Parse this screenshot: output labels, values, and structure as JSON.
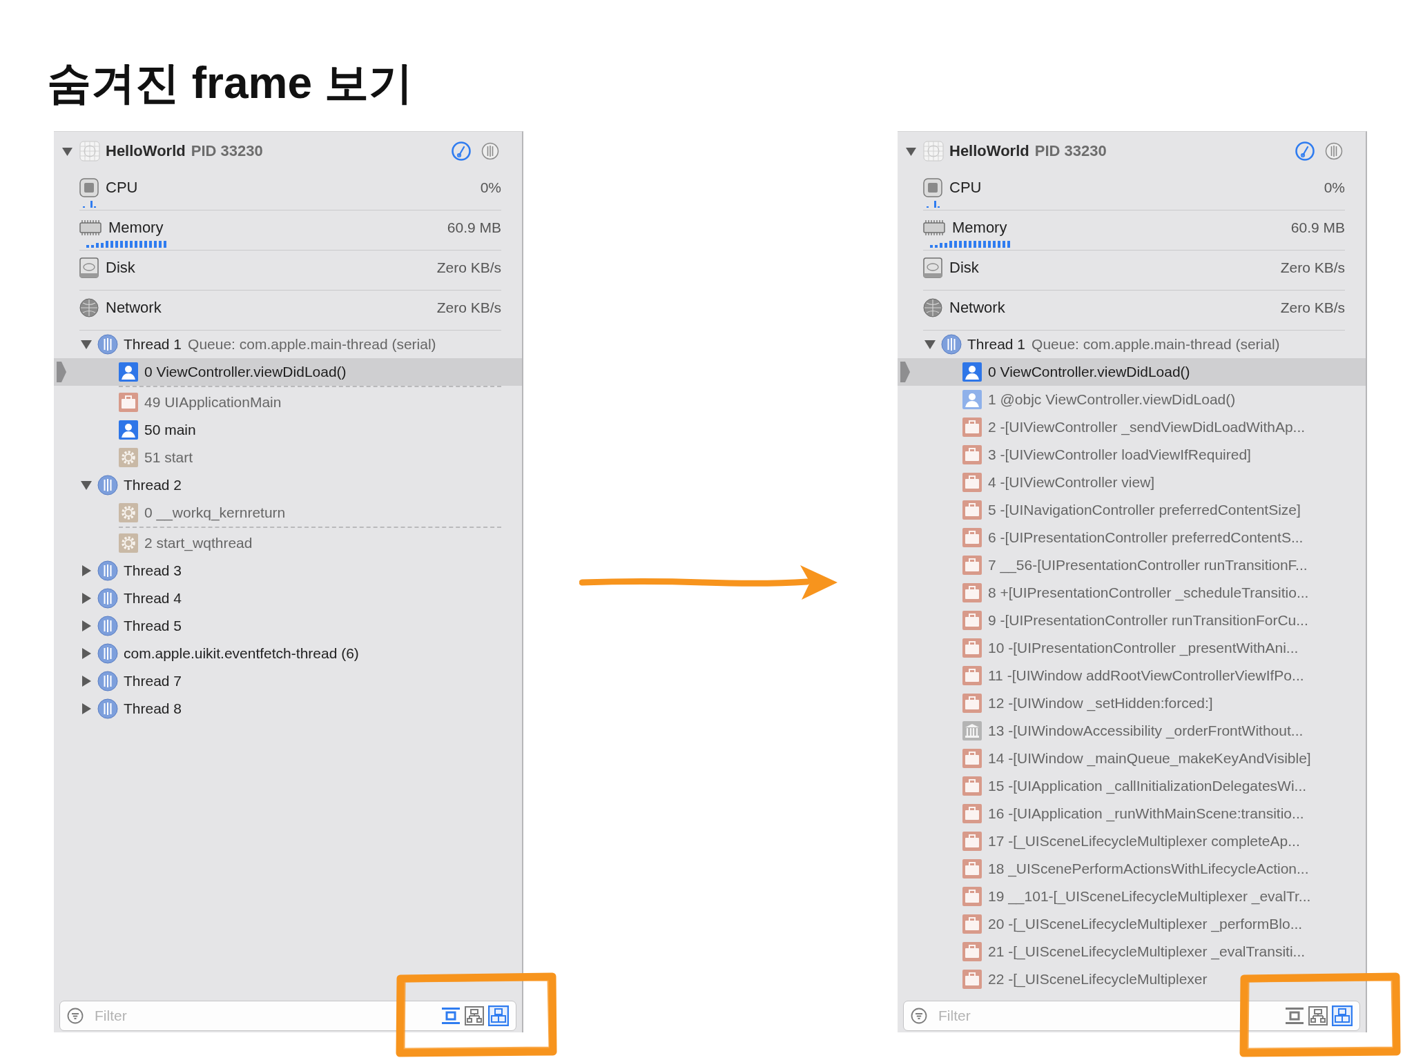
{
  "title": "숨겨진 frame 보기",
  "panels": [
    {
      "process": {
        "name": "HelloWorld",
        "pid": "PID 33230",
        "expanded": true
      },
      "metrics": [
        {
          "kind": "cpu",
          "label": "CPU",
          "value": "0%"
        },
        {
          "kind": "memory",
          "label": "Memory",
          "value": "60.9 MB"
        },
        {
          "kind": "disk",
          "label": "Disk",
          "value": "Zero KB/s"
        },
        {
          "kind": "network",
          "label": "Network",
          "value": "Zero KB/s"
        }
      ],
      "threads": [
        {
          "name": "Thread 1",
          "queue": "Queue: com.apple.main-thread (serial)",
          "expanded": true,
          "frames": [
            {
              "kind": "user",
              "label": "0 ViewController.viewDidLoad()",
              "dimmed": false,
              "selected": true,
              "gap_after": true
            },
            {
              "kind": "framework",
              "label": "49 UIApplicationMain",
              "dimmed": true,
              "selected": false,
              "gap_after": false
            },
            {
              "kind": "user",
              "label": "50 main",
              "dimmed": false,
              "selected": false,
              "gap_after": false
            },
            {
              "kind": "system",
              "label": "51 start",
              "dimmed": true,
              "selected": false,
              "gap_after": false
            }
          ]
        },
        {
          "name": "Thread 2",
          "expanded": true,
          "frames": [
            {
              "kind": "system",
              "label": "0 __workq_kernreturn",
              "dimmed": true,
              "selected": false,
              "gap_after": true
            },
            {
              "kind": "system",
              "label": "2 start_wqthread",
              "dimmed": true,
              "selected": false,
              "gap_after": false
            }
          ]
        },
        {
          "name": "Thread 3",
          "expanded": false
        },
        {
          "name": "Thread 4",
          "expanded": false
        },
        {
          "name": "Thread 5",
          "expanded": false
        },
        {
          "name": "com.apple.uikit.eventfetch-thread (6)",
          "expanded": false
        },
        {
          "name": "Thread 7",
          "expanded": false
        },
        {
          "name": "Thread 8",
          "expanded": false
        }
      ],
      "filter": {
        "placeholder": "Filter",
        "toggles": [
          {
            "on": true
          },
          {
            "on": false
          },
          {
            "on": true
          }
        ]
      }
    },
    {
      "process": {
        "name": "HelloWorld",
        "pid": "PID 33230",
        "expanded": true
      },
      "metrics": [
        {
          "kind": "cpu",
          "label": "CPU",
          "value": "0%"
        },
        {
          "kind": "memory",
          "label": "Memory",
          "value": "60.9 MB"
        },
        {
          "kind": "disk",
          "label": "Disk",
          "value": "Zero KB/s"
        },
        {
          "kind": "network",
          "label": "Network",
          "value": "Zero KB/s"
        }
      ],
      "threads": [
        {
          "name": "Thread 1",
          "queue": "Queue: com.apple.main-thread (serial)",
          "expanded": true,
          "frames": [
            {
              "kind": "user",
              "label": "0 ViewController.viewDidLoad()",
              "dimmed": false,
              "selected": true,
              "gap_after": false
            },
            {
              "kind": "user",
              "label": "1 @objc ViewController.viewDidLoad()",
              "dimmed": true,
              "selected": false,
              "gap_after": false
            },
            {
              "kind": "framework",
              "label": "2 -[UIViewController _sendViewDidLoadWithAp...",
              "dimmed": true,
              "selected": false,
              "gap_after": false
            },
            {
              "kind": "framework",
              "label": "3 -[UIViewController loadViewIfRequired]",
              "dimmed": true,
              "selected": false,
              "gap_after": false
            },
            {
              "kind": "framework",
              "label": "4 -[UIViewController view]",
              "dimmed": true,
              "selected": false,
              "gap_after": false
            },
            {
              "kind": "framework",
              "label": "5 -[UINavigationController preferredContentSize]",
              "dimmed": true,
              "selected": false,
              "gap_after": false
            },
            {
              "kind": "framework",
              "label": "6 -[UIPresentationController preferredContentS...",
              "dimmed": true,
              "selected": false,
              "gap_after": false
            },
            {
              "kind": "framework",
              "label": "7 __56-[UIPresentationController runTransitionF...",
              "dimmed": true,
              "selected": false,
              "gap_after": false
            },
            {
              "kind": "framework",
              "label": "8 +[UIPresentationController _scheduleTransitio...",
              "dimmed": true,
              "selected": false,
              "gap_after": false
            },
            {
              "kind": "framework",
              "label": "9 -[UIPresentationController runTransitionForCu...",
              "dimmed": true,
              "selected": false,
              "gap_after": false
            },
            {
              "kind": "framework",
              "label": "10 -[UIPresentationController _presentWithAni...",
              "dimmed": true,
              "selected": false,
              "gap_after": false
            },
            {
              "kind": "framework",
              "label": "11 -[UIWindow addRootViewControllerViewIfPo...",
              "dimmed": true,
              "selected": false,
              "gap_after": false
            },
            {
              "kind": "framework",
              "label": "12 -[UIWindow _setHidden:forced:]",
              "dimmed": true,
              "selected": false,
              "gap_after": false
            },
            {
              "kind": "library",
              "label": "13 -[UIWindowAccessibility _orderFrontWithout...",
              "dimmed": true,
              "selected": false,
              "gap_after": false
            },
            {
              "kind": "framework",
              "label": "14 -[UIWindow _mainQueue_makeKeyAndVisible]",
              "dimmed": true,
              "selected": false,
              "gap_after": false
            },
            {
              "kind": "framework",
              "label": "15 -[UIApplication _callInitializationDelegatesWi...",
              "dimmed": true,
              "selected": false,
              "gap_after": false
            },
            {
              "kind": "framework",
              "label": "16 -[UIApplication _runWithMainScene:transitio...",
              "dimmed": true,
              "selected": false,
              "gap_after": false
            },
            {
              "kind": "framework",
              "label": "17 -[_UISceneLifecycleMultiplexer completeAp...",
              "dimmed": true,
              "selected": false,
              "gap_after": false
            },
            {
              "kind": "framework",
              "label": "18 _UIScenePerformActionsWithLifecycleAction...",
              "dimmed": true,
              "selected": false,
              "gap_after": false
            },
            {
              "kind": "framework",
              "label": "19 __101-[_UISceneLifecycleMultiplexer _evalTr...",
              "dimmed": true,
              "selected": false,
              "gap_after": false
            },
            {
              "kind": "framework",
              "label": "20 -[_UISceneLifecycleMultiplexer _performBlo...",
              "dimmed": true,
              "selected": false,
              "gap_after": false
            },
            {
              "kind": "framework",
              "label": "21 -[_UISceneLifecycleMultiplexer _evalTransiti...",
              "dimmed": true,
              "selected": false,
              "gap_after": false
            },
            {
              "kind": "framework",
              "label": "22 -[_UISceneLifecycleMultiplexer",
              "dimmed": true,
              "selected": false,
              "gap_after": false
            }
          ]
        }
      ],
      "filter": {
        "placeholder": "Filter",
        "toggles": [
          {
            "on": false
          },
          {
            "on": false
          },
          {
            "on": true
          }
        ]
      }
    }
  ]
}
